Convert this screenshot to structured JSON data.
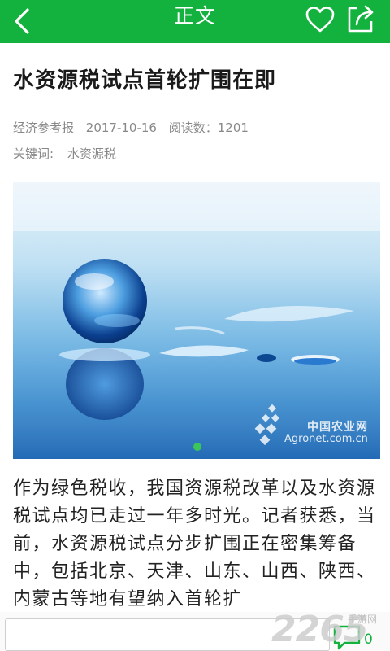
{
  "header": {
    "title": "正文",
    "back_icon": "chevron-left-icon",
    "favorite_icon": "heart-outline-icon",
    "share_icon": "share-export-icon",
    "bg_color": "#13b13d"
  },
  "article": {
    "headline": "水资源税试点首轮扩围在即",
    "source": "经济参考报",
    "date": "2017-10-16",
    "reads_label": "阅读数：1201",
    "keywords_label": "关键词:",
    "keyword": "水资源税",
    "image": {
      "watermark_cn": "中国农业网",
      "watermark_en": "Agronet.com.cn",
      "carousel_pages": 1,
      "carousel_active": 1
    },
    "body": "作为绿色税收，我国资源税改革以及水资源税试点均已走过一年多时光。记者获悉，当前，水资源税试点分步扩围正在密集筹备中，包括北京、天津、山东、山西、陕西、内蒙古等地有望纳入首轮扩"
  },
  "bottom_bar": {
    "comment_placeholder": "",
    "comment_icon": "comment-bubble-icon",
    "comment_count": "0"
  },
  "site_watermark": {
    "main": "2265",
    "sub": "手游网"
  }
}
